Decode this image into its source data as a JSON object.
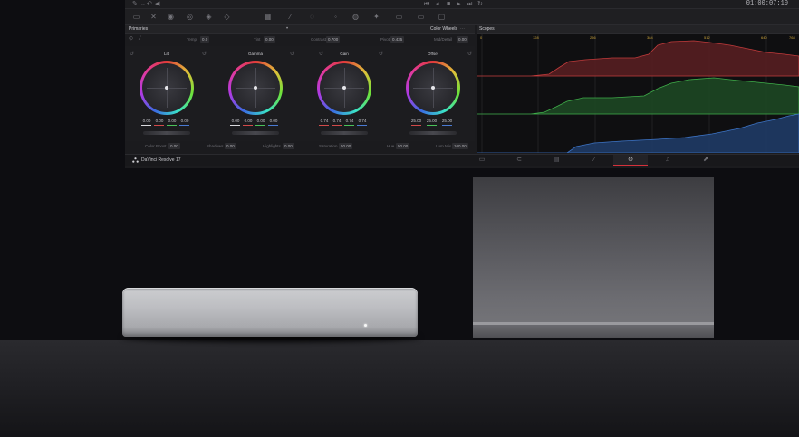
{
  "app": {
    "name": "DaVinci Resolve 17",
    "timecode": "01:00:07:10"
  },
  "primaries": {
    "title": "Primaries",
    "mode": "Color Wheels",
    "top_params": [
      {
        "label": "Temp",
        "value": "0.0"
      },
      {
        "label": "Tint",
        "value": "0.00"
      },
      {
        "label": "Contrast",
        "value": "0.700"
      },
      {
        "label": "Pivot",
        "value": "0.435"
      },
      {
        "label": "Mid/Detail",
        "value": "0.00"
      }
    ],
    "wheels": [
      {
        "name": "Lift",
        "values": [
          "0.00",
          "0.00",
          "0.00",
          "0.00"
        ],
        "line_colors": [
          "#d9d9dd",
          "#d24a4a",
          "#4ac25a",
          "#4a7ad2"
        ]
      },
      {
        "name": "Gamma",
        "values": [
          "0.00",
          "0.00",
          "0.00",
          "0.00"
        ],
        "line_colors": [
          "#d9d9dd",
          "#d24a4a",
          "#4ac25a",
          "#4a7ad2"
        ]
      },
      {
        "name": "Gain",
        "values": [
          "0.74",
          "0.74",
          "0.74",
          "0.74"
        ],
        "line_colors": [
          "#d24a4a",
          "#d24a4a",
          "#4ac25a",
          "#4a7ad2"
        ]
      },
      {
        "name": "Offset",
        "values": [
          "25.00",
          "25.00",
          "25.00"
        ],
        "line_colors": [
          "#d24a4a",
          "#4ac25a",
          "#4a7ad2"
        ]
      }
    ],
    "bottom_params": [
      {
        "label": "Color Boost",
        "value": "0.00"
      },
      {
        "label": "Shadows",
        "value": "0.00"
      },
      {
        "label": "Highlights",
        "value": "0.00"
      },
      {
        "label": "Saturation",
        "value": "50.00"
      },
      {
        "label": "Hue",
        "value": "50.00"
      },
      {
        "label": "Lum Mix",
        "value": "100.00"
      }
    ]
  },
  "scopes": {
    "title": "Scopes",
    "scale_labels": [
      "0",
      "128",
      "256",
      "384",
      "512",
      "640",
      "768"
    ],
    "colors": {
      "red": "#c23b3b",
      "green": "#3fae4a",
      "blue": "#3d74c6"
    }
  },
  "pages": [
    {
      "icon": "media-icon",
      "active": false
    },
    {
      "icon": "cut-icon",
      "active": false
    },
    {
      "icon": "edit-icon",
      "active": false
    },
    {
      "icon": "fusion-icon",
      "active": false
    },
    {
      "icon": "color-icon",
      "active": true
    },
    {
      "icon": "fairlight-icon",
      "active": false
    },
    {
      "icon": "deliver-icon",
      "active": false
    }
  ],
  "accent_color": "#d4313b"
}
